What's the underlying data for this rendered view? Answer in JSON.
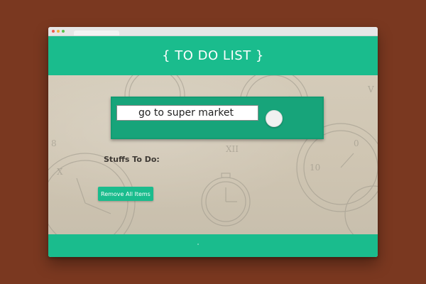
{
  "header": {
    "title": "{ TO DO LIST }"
  },
  "todo": {
    "input_value": "go to super market",
    "add_button_label": ""
  },
  "list": {
    "heading": "Stuffs To Do:"
  },
  "actions": {
    "remove_all_label": "Remove All Items"
  },
  "icons": {
    "background": "clock-pattern-icon"
  },
  "colors": {
    "accent": "#1abc8d",
    "panel": "#17a47a",
    "page_background": "#7a3820"
  }
}
